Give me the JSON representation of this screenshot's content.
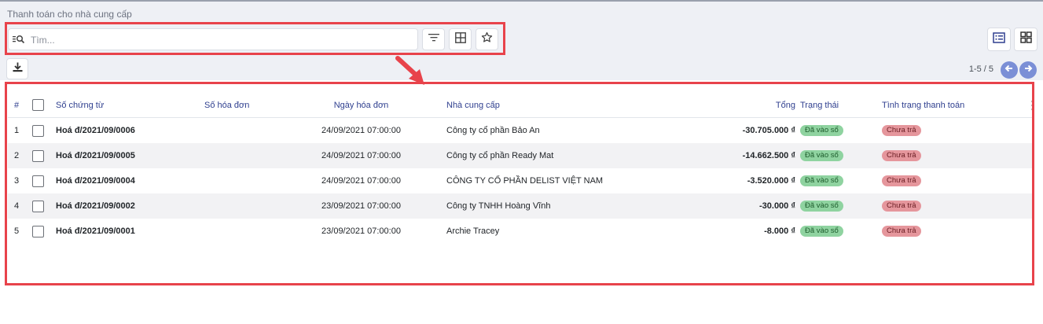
{
  "breadcrumb": "Thanh toán cho nhà cung cấp",
  "search": {
    "placeholder": "Tìm..."
  },
  "pager": {
    "text": "1-5 / 5"
  },
  "table": {
    "headers": {
      "index": "#",
      "voucher_no": "Số chứng từ",
      "invoice_no": "Số hóa đơn",
      "invoice_date": "Ngày hóa đơn",
      "vendor": "Nhà cung cấp",
      "total": "Tổng",
      "status": "Trạng thái",
      "payment_status": "Tình trạng thanh toán"
    },
    "rows": [
      {
        "index": "1",
        "voucher_no": "Hoá đ/2021/09/0006",
        "invoice_no": "",
        "invoice_date": "24/09/2021 07:00:00",
        "vendor": "Công ty cổ phần Bảo An",
        "total": "-30.705.000 ₫",
        "status": "Đã vào sổ",
        "payment_status": "Chưa trả"
      },
      {
        "index": "2",
        "voucher_no": "Hoá đ/2021/09/0005",
        "invoice_no": "",
        "invoice_date": "24/09/2021 07:00:00",
        "vendor": "Công ty cổ phần Ready Mat",
        "total": "-14.662.500 ₫",
        "status": "Đã vào sổ",
        "payment_status": "Chưa trả"
      },
      {
        "index": "3",
        "voucher_no": "Hoá đ/2021/09/0004",
        "invoice_no": "",
        "invoice_date": "24/09/2021 07:00:00",
        "vendor": "CÔNG TY CỔ PHẦN DELIST VIỆT NAM",
        "total": "-3.520.000 ₫",
        "status": "Đã vào sổ",
        "payment_status": "Chưa trả"
      },
      {
        "index": "4",
        "voucher_no": "Hoá đ/2021/09/0002",
        "invoice_no": "",
        "invoice_date": "23/09/2021 07:00:00",
        "vendor": "Công ty TNHH Hoàng Vĩnh",
        "total": "-30.000 ₫",
        "status": "Đã vào sổ",
        "payment_status": "Chưa trả"
      },
      {
        "index": "5",
        "voucher_no": "Hoá đ/2021/09/0001",
        "invoice_no": "",
        "invoice_date": "23/09/2021 07:00:00",
        "vendor": "Archie Tracey",
        "total": "-8.000 ₫",
        "status": "Đã vào sổ",
        "payment_status": "Chưa trả"
      }
    ]
  },
  "colors": {
    "accent": "#2f3f8f",
    "highlight": "#e8434b",
    "status_posted": "#8fd3a0",
    "status_unpaid": "#e5969c",
    "pager_button": "#7b8fd6"
  },
  "icons": {
    "search": "search-icon",
    "filter": "filter-icon",
    "group_by": "group-by-icon",
    "favorite": "star-icon",
    "list_view": "list-view-icon",
    "kanban_view": "kanban-view-icon",
    "export": "download-icon",
    "prev": "arrow-left-icon",
    "next": "arrow-right-icon",
    "optional_columns": "vertical-dots-icon"
  }
}
